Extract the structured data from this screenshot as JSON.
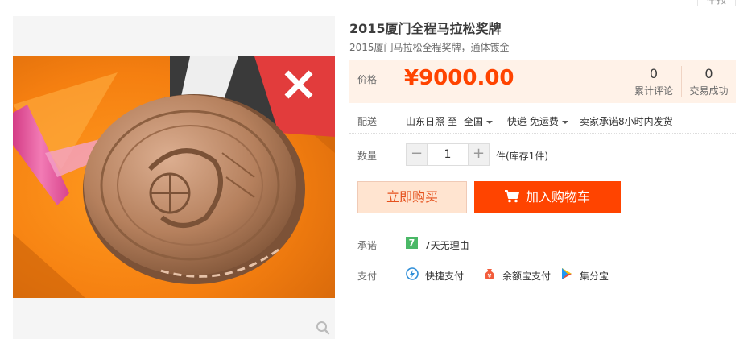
{
  "report_label": "举报",
  "product": {
    "title": "2015厦门全程马拉松奖牌",
    "subtitle": "2015厦门马拉松全程奖牌，通体镀金"
  },
  "price": {
    "label": "价格",
    "value": "¥9000.00"
  },
  "stats": {
    "reviews_count": "0",
    "reviews_label": "累计评论",
    "sales_count": "0",
    "sales_label": "交易成功"
  },
  "shipping": {
    "label": "配送",
    "from": "山东日照 至",
    "to": "全国",
    "method": "快递 免运费",
    "promise": "卖家承诺8小时内发货"
  },
  "quantity": {
    "label": "数量",
    "value": "1",
    "minus": "−",
    "plus": "+",
    "stock": "件(库存1件)"
  },
  "actions": {
    "buy_now": "立即购买",
    "add_to_cart": "加入购物车"
  },
  "promise": {
    "label": "承诺",
    "badge": "7",
    "text": "7天无理由"
  },
  "payment": {
    "label": "支付",
    "methods": [
      {
        "name": "快捷支付",
        "icon": "quick-pay-icon"
      },
      {
        "name": "余额宝支付",
        "icon": "yuebao-icon"
      },
      {
        "name": "集分宝",
        "icon": "jifenbao-icon"
      }
    ]
  },
  "colors": {
    "accent": "#ff4400",
    "price_bg": "#fff2e8",
    "buy_bg": "#ffe4d0",
    "promise_badge": "#4ab866",
    "medal": "#b27a56",
    "ribbon": "#e8559a"
  }
}
